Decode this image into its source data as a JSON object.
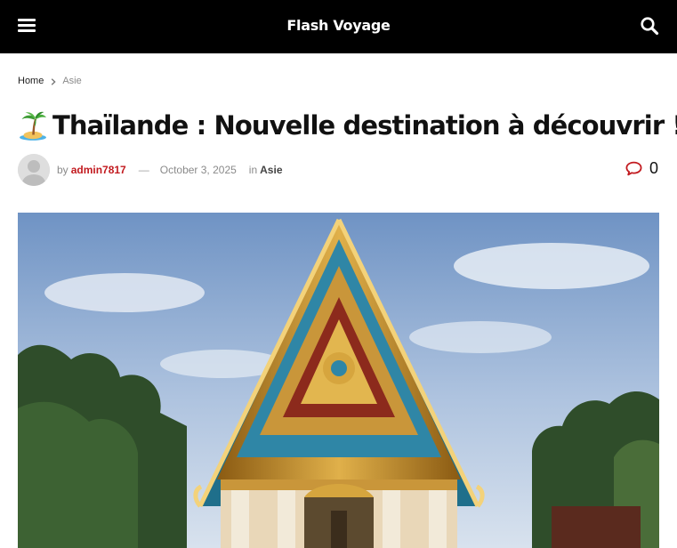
{
  "header": {
    "brand": "Flash Voyage",
    "menu_icon": "hamburger-menu-icon",
    "search_icon": "search-icon",
    "background_color": "#000000"
  },
  "breadcrumb": {
    "home": "Home",
    "current": "Asie",
    "separator_icon": "chevron-right-icon"
  },
  "article": {
    "emoji_icon": "palm-tree-island-icon",
    "title": "Thaïlande : Nouvelle destination à découvrir !",
    "meta": {
      "by": "by",
      "author": "admin7817",
      "dash": "—",
      "date": "October 3, 2025",
      "in": "in",
      "category": "Asie",
      "comment_icon": "comment-icon",
      "comment_count": "0",
      "author_color": "#c21a1f"
    },
    "hero_image": "thai-temple-photo"
  }
}
